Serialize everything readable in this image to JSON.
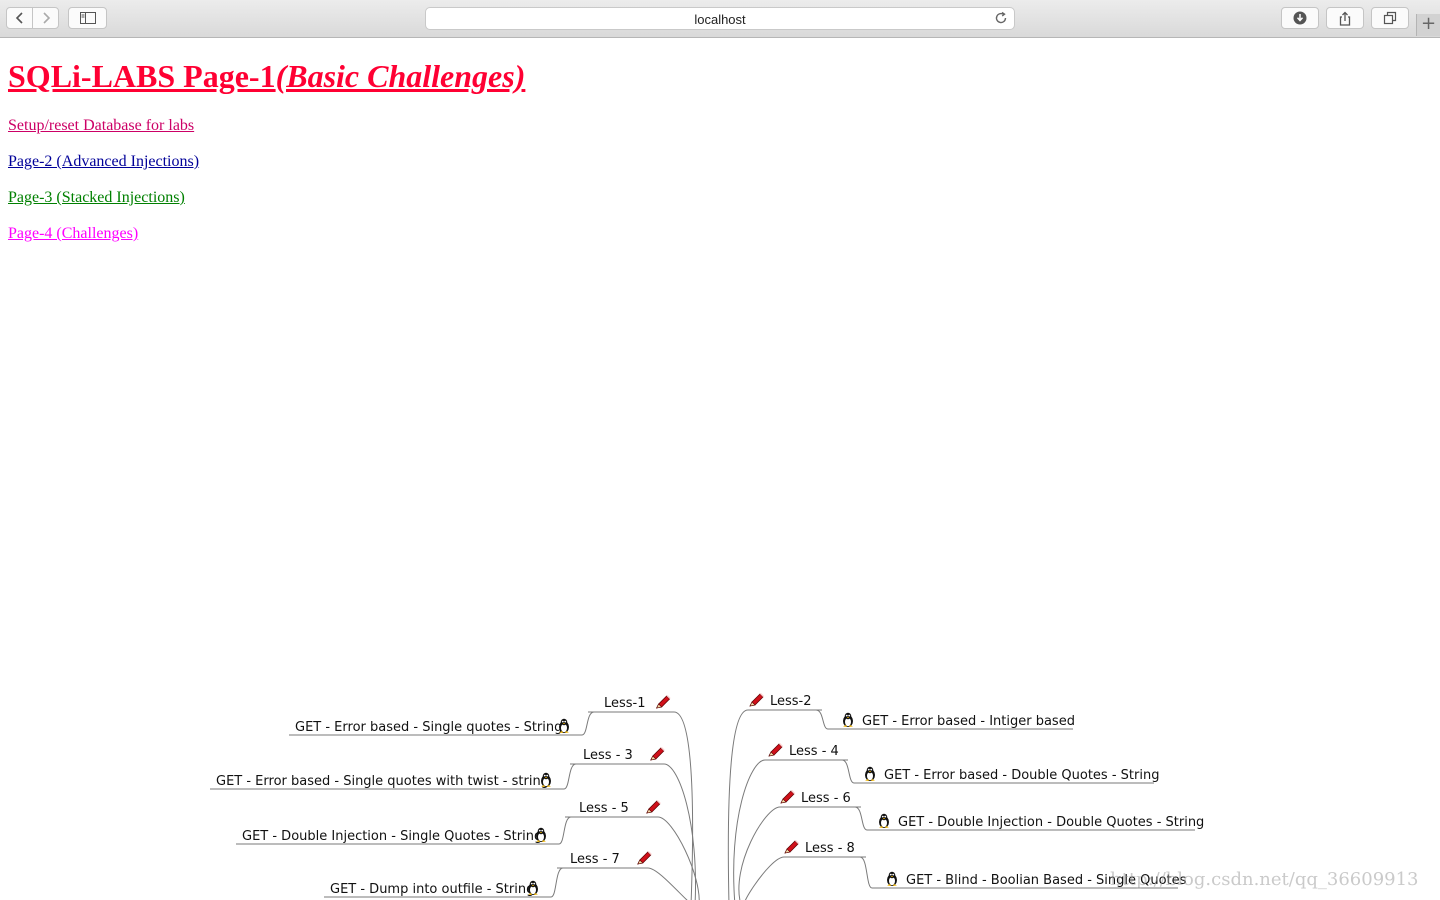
{
  "browser": {
    "url": "localhost"
  },
  "page": {
    "title_main": "SQLi-LABS Page-1",
    "title_sub": "(Basic Challenges)",
    "links": [
      {
        "label": "Setup/reset Database for labs",
        "color": "#cc0066"
      },
      {
        "label": "Page-2 (Advanced Injections)",
        "color": "#000099"
      },
      {
        "label": "Page-3 (Stacked Injections)",
        "color": "#008000"
      },
      {
        "label": "Page-4 (Challenges)",
        "color": "#ff00ff"
      }
    ]
  },
  "mindmap": {
    "left": [
      {
        "less": "Less-1",
        "desc": "GET - Error based - Single quotes - String"
      },
      {
        "less": "Less - 3",
        "desc": "GET - Error based - Single quotes with twist - string"
      },
      {
        "less": "Less - 5",
        "desc": "GET - Double Injection - Single Quotes - String"
      },
      {
        "less": "Less - 7",
        "desc": "GET - Dump into outfile - String"
      }
    ],
    "right": [
      {
        "less": "Less-2",
        "desc": "GET - Error based - Intiger based"
      },
      {
        "less": "Less - 4",
        "desc": "GET - Error based - Double Quotes - String"
      },
      {
        "less": "Less - 6",
        "desc": "GET - Double Injection - Double Quotes - String"
      },
      {
        "less": "Less - 8",
        "desc": "GET - Blind - Boolian Based - Single Quotes"
      }
    ],
    "icons": {
      "less": "pencil-icon",
      "desc": "tux-penguin-icon"
    }
  },
  "watermark": "http://blog.csdn.net/qq_36609913"
}
